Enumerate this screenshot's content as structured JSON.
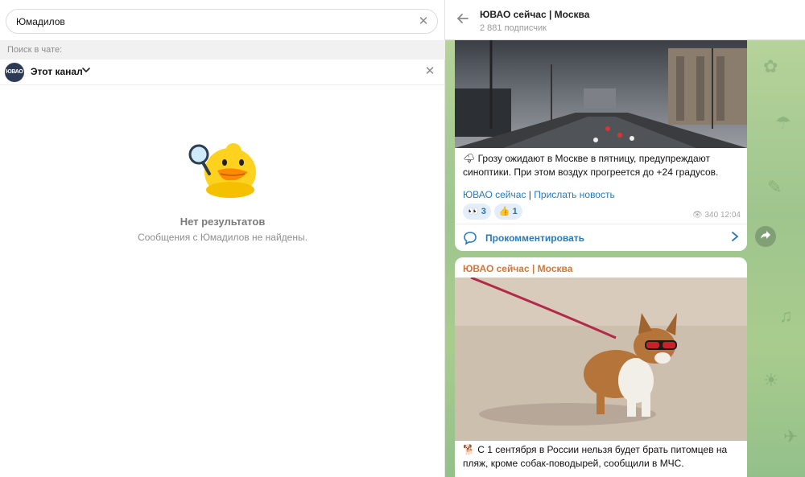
{
  "search": {
    "value": "Юмадилов",
    "clear_icon": "close-icon"
  },
  "in_chat_label": "Поиск в чате:",
  "channel_filter": {
    "avatar_text": "ЮВАО",
    "label": "Этот канал",
    "chevron": "⌄"
  },
  "empty_state": {
    "title": "Нет результатов",
    "description": "Сообщения с Юмадилов не найдены."
  },
  "chat": {
    "title": "ЮВАО сейчас | Москва",
    "subscribers": "2 881 подписчик"
  },
  "messages": [
    {
      "emoji": "🌩",
      "text": "Грозу ожидают в Москве в пятницу, предупреждают синоптики. При этом воздух прогреется до +24 градусов.",
      "link1": "ЮВАО сейчас",
      "separator": "|",
      "link2": "Прислать новость",
      "reactions": [
        {
          "emoji": "👀",
          "count": "3"
        },
        {
          "emoji": "👍",
          "count": "1"
        }
      ],
      "views": "340",
      "time": "12:04",
      "comment_label": "Прокомментировать"
    },
    {
      "sender": "ЮВАО сейчас | Москва",
      "emoji": "🐕",
      "text": "С 1 сентября в России нельзя будет брать питомцев на пляж, кроме собак-поводырей, сообщили в МЧС."
    }
  ],
  "colors": {
    "accent": "#2a7ab8",
    "sender": "#d2773a",
    "wallpaper": "#a8c98f"
  }
}
